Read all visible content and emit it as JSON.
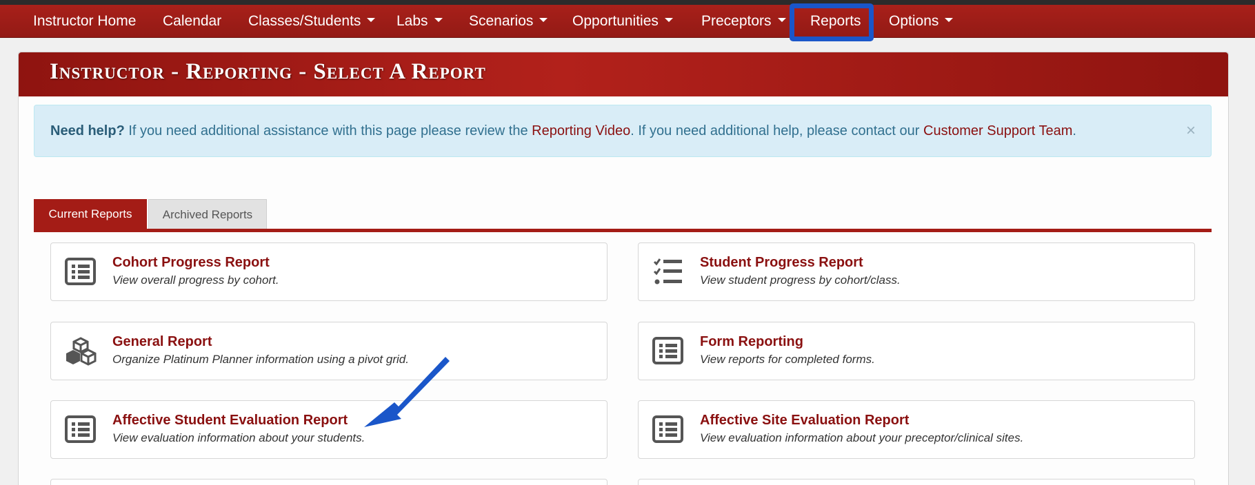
{
  "nav": {
    "items": [
      {
        "label": "Instructor Home",
        "dropdown": false
      },
      {
        "label": "Calendar",
        "dropdown": false
      },
      {
        "label": "Classes/Students",
        "dropdown": true
      },
      {
        "label": "Labs",
        "dropdown": true
      },
      {
        "label": "Scenarios",
        "dropdown": true
      },
      {
        "label": "Opportunities",
        "dropdown": true
      },
      {
        "label": "Preceptors",
        "dropdown": true
      },
      {
        "label": "Reports",
        "dropdown": false,
        "highlighted": true
      },
      {
        "label": "Options",
        "dropdown": true
      }
    ]
  },
  "page": {
    "title": "Instructor - Reporting - Select A Report"
  },
  "alert": {
    "lead": "Need help?",
    "text1": " If you need additional assistance with this page please review the ",
    "link1": "Reporting Video",
    "text2": ". If you need additional help, please contact our ",
    "link2": "Customer Support Team",
    "text3": ".",
    "close": "×"
  },
  "tabs": {
    "current": "Current Reports",
    "archived": "Archived Reports"
  },
  "reports": [
    {
      "title": "Cohort Progress Report",
      "desc": "View overall progress by cohort.",
      "icon": "list-icon"
    },
    {
      "title": "Student Progress Report",
      "desc": "View student progress by cohort/class.",
      "icon": "checklist-icon"
    },
    {
      "title": "General Report",
      "desc": "Organize Platinum Planner information using a pivot grid.",
      "icon": "cubes-icon"
    },
    {
      "title": "Form Reporting",
      "desc": "View reports for completed forms.",
      "icon": "list-icon"
    },
    {
      "title": "Affective Student Evaluation Report",
      "desc": "View evaluation information about your students.",
      "icon": "list-icon"
    },
    {
      "title": "Affective Site Evaluation Report",
      "desc": "View evaluation information about your preceptor/clinical sites.",
      "icon": "list-icon"
    }
  ],
  "colors": {
    "brand_red": "#a41c16",
    "link_red": "#8a1010",
    "highlight_blue": "#1a56c9",
    "alert_bg": "#d9edf7"
  }
}
